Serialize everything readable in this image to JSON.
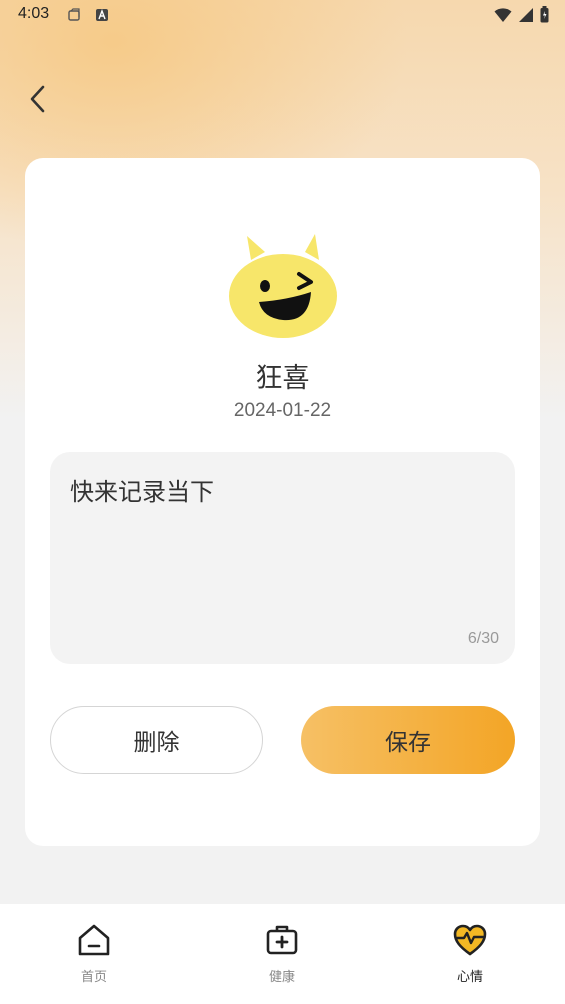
{
  "status_bar": {
    "time": "4:03"
  },
  "mood": {
    "name": "狂喜",
    "date": "2024-01-22"
  },
  "note": {
    "text": "快来记录当下",
    "count": "6/30"
  },
  "actions": {
    "delete_label": "删除",
    "save_label": "保存"
  },
  "tabs": [
    {
      "label": "首页",
      "icon": "home-icon",
      "active": false
    },
    {
      "label": "健康",
      "icon": "medical-kit-icon",
      "active": false
    },
    {
      "label": "心情",
      "icon": "heart-pulse-icon",
      "active": true
    }
  ],
  "colors": {
    "accent": "#f3a526",
    "accent_light": "#f6c065",
    "emoji_yellow": "#f7e66a"
  }
}
